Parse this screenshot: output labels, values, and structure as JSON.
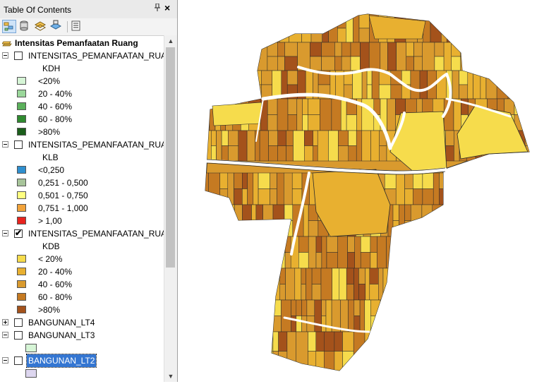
{
  "toc": {
    "title": "Table Of Contents",
    "pin_icon": "pin-icon",
    "close_label": "×",
    "toolbar": [
      {
        "name": "list-by-drawing-order-icon",
        "active": true
      },
      {
        "name": "list-by-source-icon",
        "active": false
      },
      {
        "name": "list-by-visibility-icon",
        "active": false
      },
      {
        "name": "list-by-selection-icon",
        "active": false
      },
      {
        "name": "options-icon",
        "active": false
      }
    ],
    "data_frame": "Intensitas Pemanfaatan Ruang",
    "layers": [
      {
        "name": "INTENSITAS_PEMANFAATAN_RUAN",
        "checked": false,
        "expanded": true,
        "field": "KDH",
        "classes": [
          {
            "label": "<20%",
            "color": "#d6f5d6"
          },
          {
            "label": "20 - 40%",
            "color": "#9ad79a"
          },
          {
            "label": "40 - 60%",
            "color": "#5bb05b"
          },
          {
            "label": "60 - 80%",
            "color": "#2f8a2f"
          },
          {
            "label": ">80%",
            "color": "#1b5e1b"
          }
        ]
      },
      {
        "name": "INTENSITAS_PEMANFAATAN_RUAN",
        "checked": false,
        "expanded": true,
        "field": "KLB",
        "classes": [
          {
            "label": "<0,250",
            "color": "#2f8fcf"
          },
          {
            "label": "0,251 - 0,500",
            "color": "#a7c49a"
          },
          {
            "label": "0,501 - 0,750",
            "color": "#ffff80"
          },
          {
            "label": "0,751 - 1,000",
            "color": "#f2a33a"
          },
          {
            "label": "> 1,00",
            "color": "#e8241e"
          }
        ]
      },
      {
        "name": "INTENSITAS_PEMANFAATAN_RUAN",
        "checked": true,
        "expanded": true,
        "field": "KDB",
        "classes": [
          {
            "label": "< 20%",
            "color": "#f6dc4c"
          },
          {
            "label": "20 - 40%",
            "color": "#e8b030"
          },
          {
            "label": "40 - 60%",
            "color": "#d99a2e"
          },
          {
            "label": "60 - 80%",
            "color": "#c57a22"
          },
          {
            "label": ">80%",
            "color": "#a4521b"
          }
        ]
      },
      {
        "name": "BANGUNAN_LT4",
        "checked": false,
        "expanded": false,
        "classes": []
      },
      {
        "name": "BANGUNAN_LT3",
        "checked": false,
        "expanded": true,
        "classes": [
          {
            "label": "",
            "color": "#d6f5d6"
          }
        ]
      },
      {
        "name": "BANGUNAN_LT2",
        "checked": false,
        "expanded": true,
        "selected": true,
        "classes": [
          {
            "label": "",
            "color": "#ddd6ef"
          }
        ]
      }
    ],
    "scroll_up": "▲",
    "scroll_down": "▼"
  },
  "map": {
    "layer_shown": "KDB",
    "outline_color": "#2b2b2b",
    "road_color": "#ffffff"
  }
}
